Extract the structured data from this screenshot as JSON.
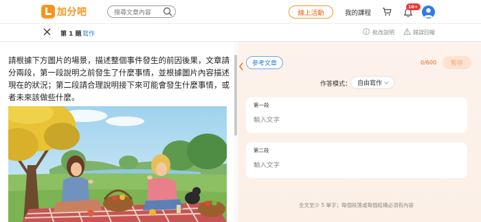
{
  "nav": {
    "logo_text": "加分吧",
    "search_placeholder": "搜尋文章內容",
    "live_label": "線上活動",
    "my_course": "我的課程",
    "notification_badge": "10+",
    "brand_color": "#f7941d"
  },
  "subheader": {
    "question_title": "第 1 題",
    "question_type": "寫作",
    "grading_label": "批改說明",
    "report_label": "錯誤回報"
  },
  "prompt": {
    "text": "請根據下方圖片的場景，描述整個事件發生的前因後果，文章請分兩段，第一段說明之前發生了什麼事情，並根據圖片內容描述現在的狀況；第二段請合理說明接下來可能會發生什麼事情，或者未來該做些什麼。"
  },
  "editor": {
    "reference_label": "參考文章",
    "word_count": "0/600",
    "save_label": "暫存",
    "mode_label": "作答模式：",
    "mode_value": "自由寫作",
    "paragraphs": [
      {
        "title": "第一段",
        "placeholder": "輸入文字",
        "value": ""
      },
      {
        "title": "第二段",
        "placeholder": "輸入文字",
        "value": ""
      }
    ],
    "footnote": "全文至少 5 單字；每個段落或每個結構必須有內容"
  }
}
